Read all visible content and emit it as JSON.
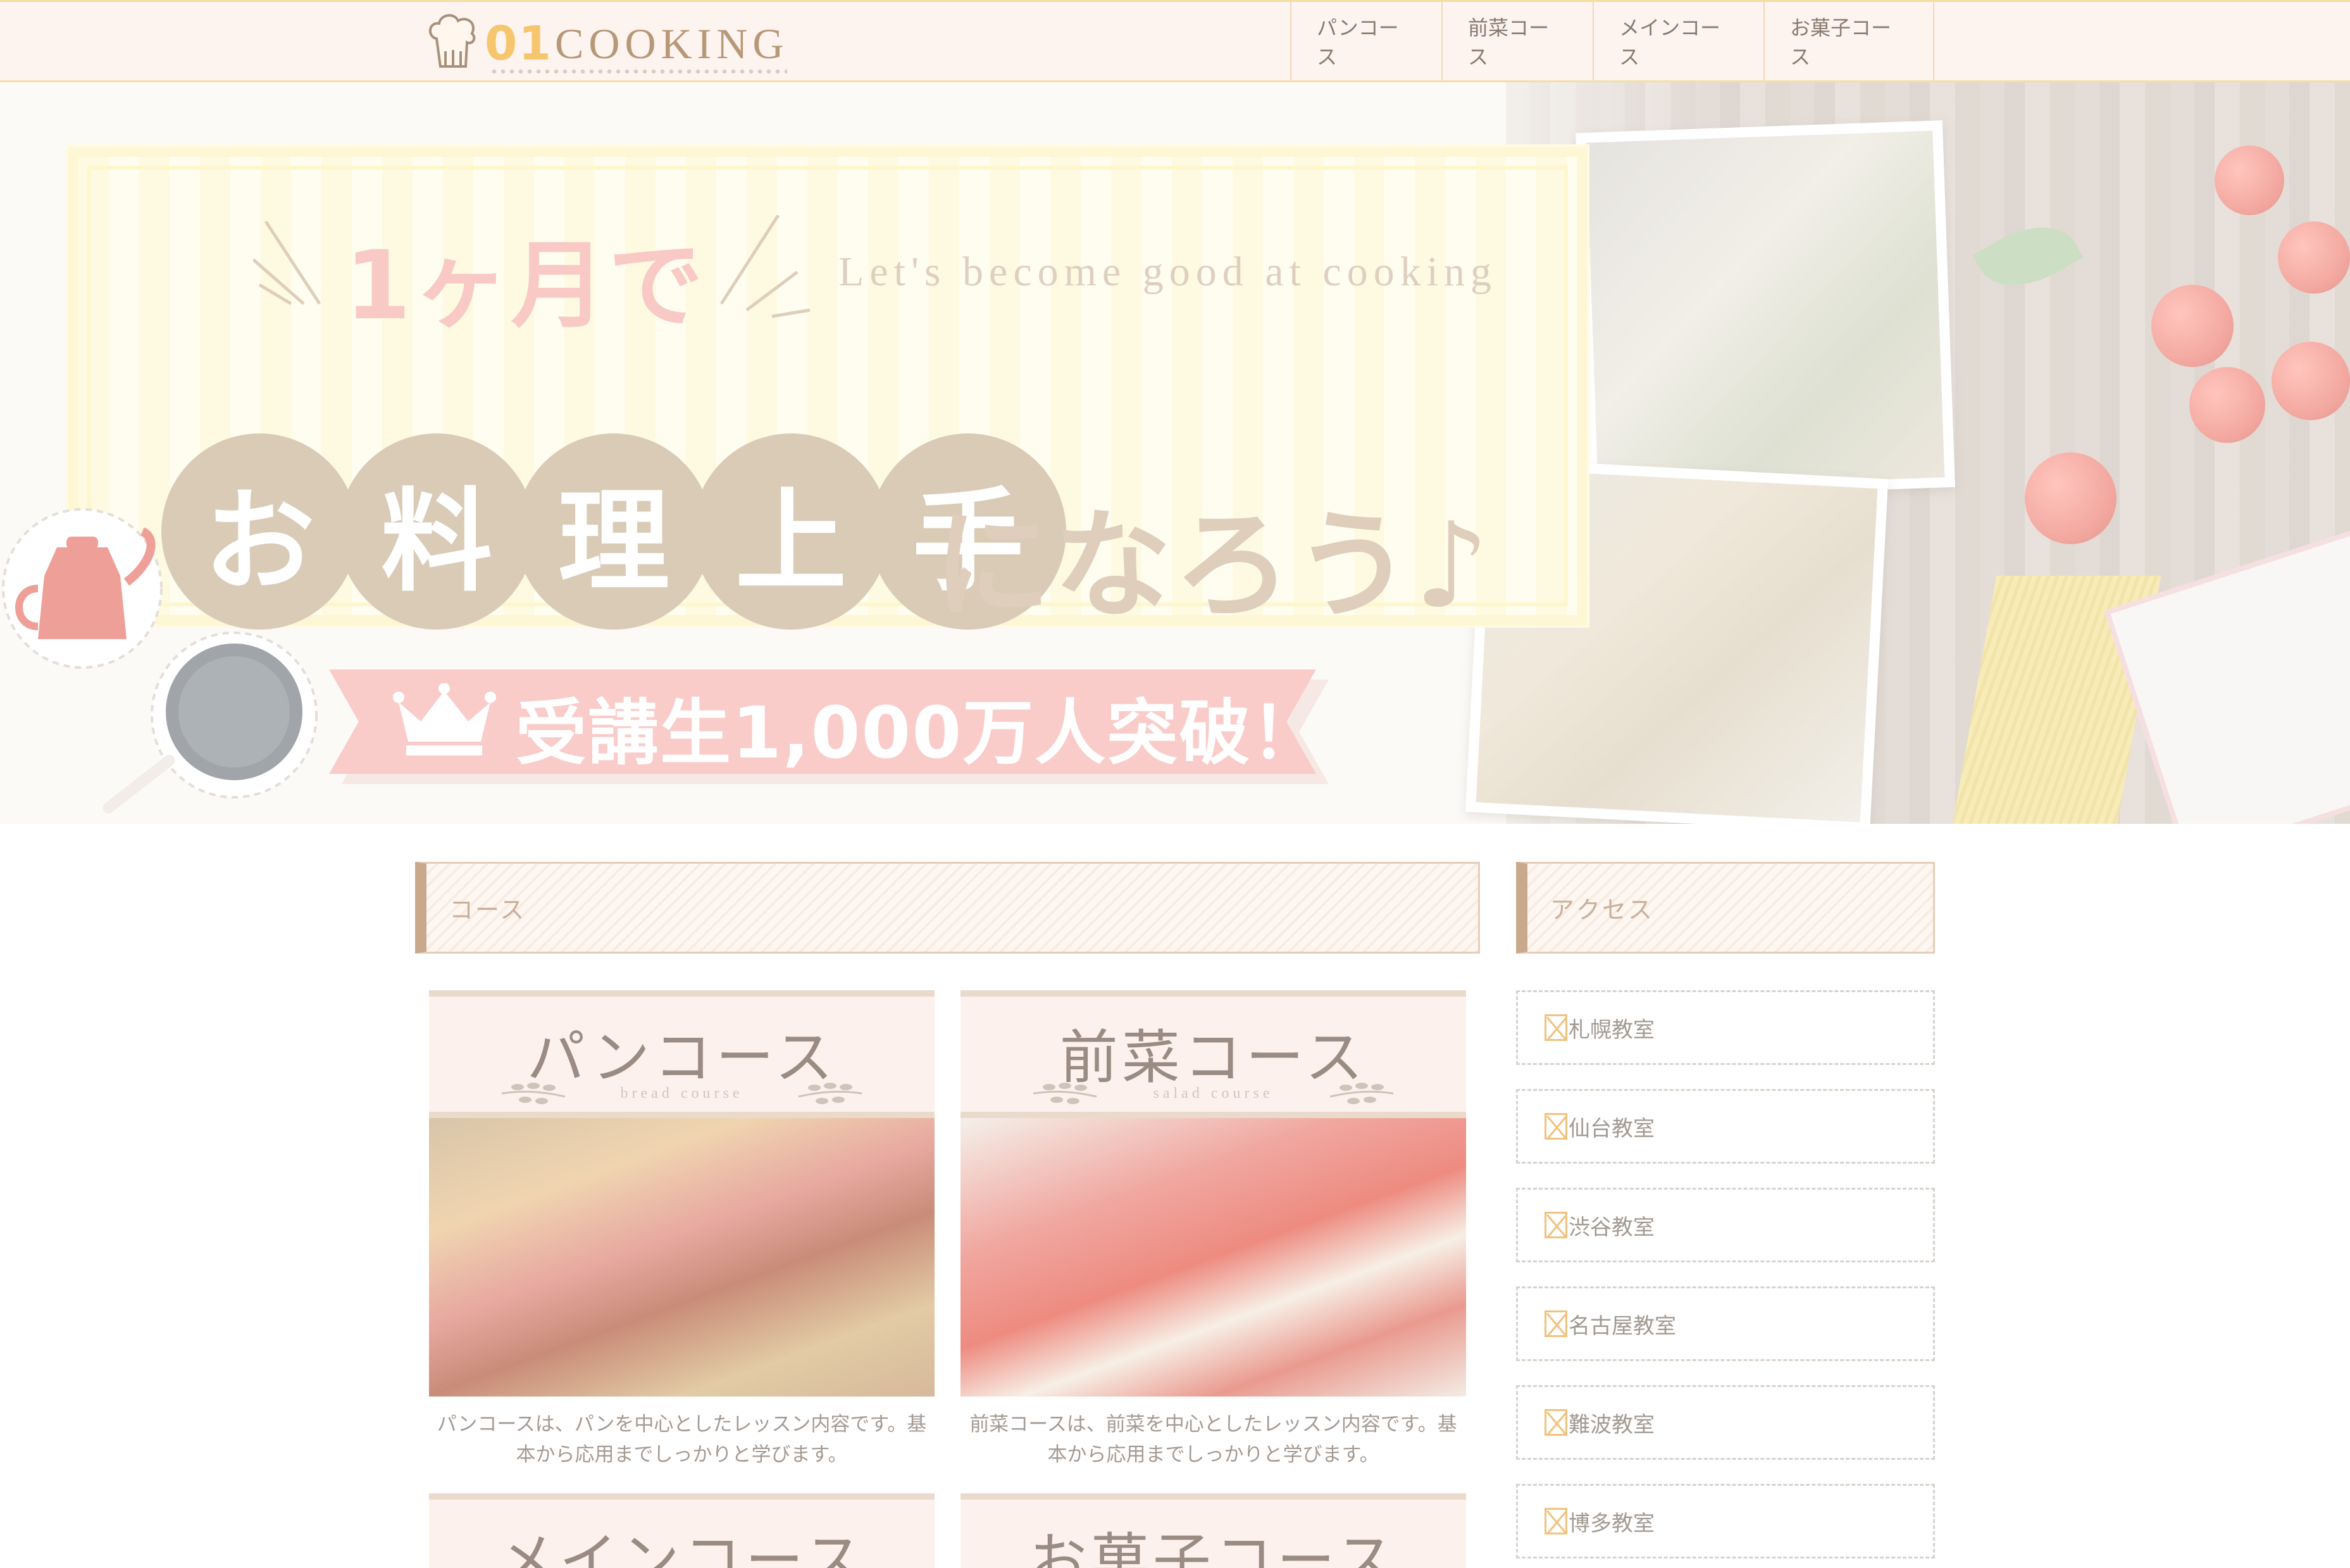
{
  "header": {
    "logo_number": "01",
    "logo_word": "COOKING",
    "nav": [
      {
        "label": "パンコース"
      },
      {
        "label": "前菜コース"
      },
      {
        "label": "メインコース"
      },
      {
        "label": "お菓子コース"
      }
    ]
  },
  "hero": {
    "headline_top": "1ヶ月で",
    "tagline": "Let's become good at cooking",
    "circle_chars": [
      "お",
      "料",
      "理",
      "上",
      "手"
    ],
    "headline_rest": "になろう♪",
    "ribbon_text": "受講生1,000万人突破！"
  },
  "sections": {
    "course_heading": "コース",
    "access_heading": "アクセス"
  },
  "courses": [
    {
      "title": "パンコース",
      "subtitle": "bread course",
      "description_line1": "パンコースは、パンを中心としたレッスン内容です。基",
      "description_line2": "本から応用までしっかりと学びます。"
    },
    {
      "title": "前菜コース",
      "subtitle": "salad course",
      "description_line1": "前菜コースは、前菜を中心としたレッスン内容です。基",
      "description_line2": "本から応用までしっかりと学びます。"
    },
    {
      "title": "メインコース"
    },
    {
      "title": "お菓子コース"
    }
  ],
  "access": [
    {
      "label": "札幌教室"
    },
    {
      "label": "仙台教室"
    },
    {
      "label": "渋谷教室"
    },
    {
      "label": "名古屋教室"
    },
    {
      "label": "難波教室"
    },
    {
      "label": "博多教室"
    }
  ]
}
